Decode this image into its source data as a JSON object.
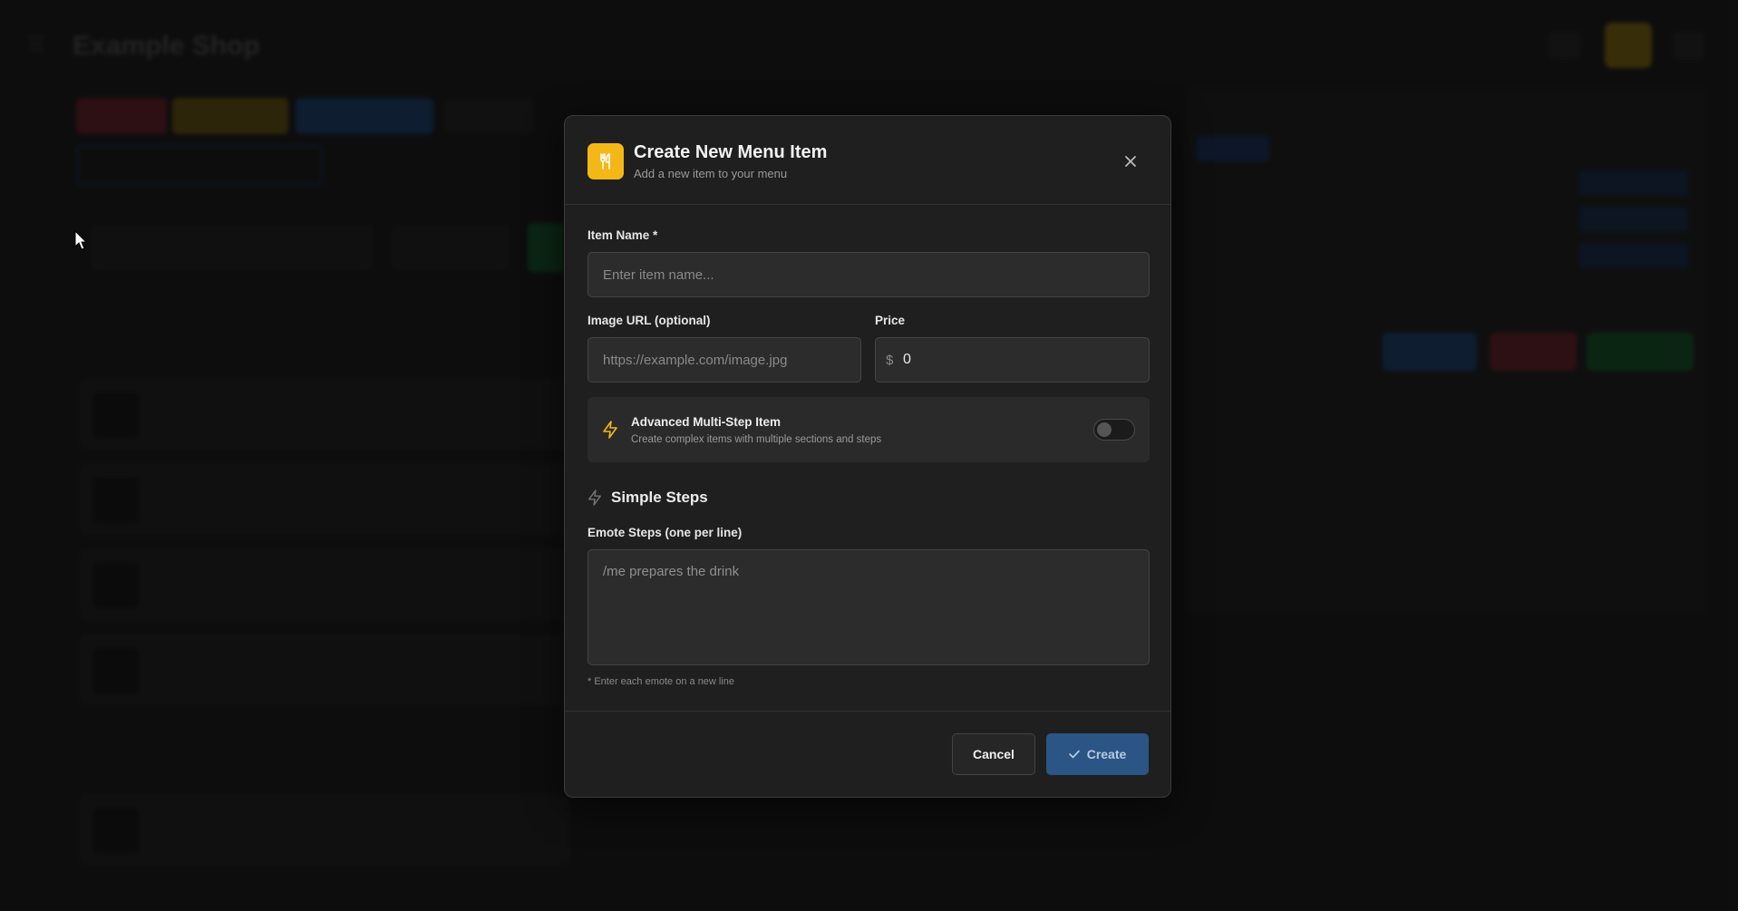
{
  "app": {
    "title": "Example Shop"
  },
  "modal": {
    "title": "Create New Menu Item",
    "subtitle": "Add a new item to your menu",
    "header_icon": "utensils-icon",
    "close_icon": "close-icon",
    "item_name": {
      "label": "Item Name *",
      "placeholder": "Enter item name...",
      "value": ""
    },
    "image_url": {
      "label": "Image URL (optional)",
      "placeholder": "https://example.com/image.jpg",
      "value": ""
    },
    "price": {
      "label": "Price",
      "prefix": "$",
      "value": "0"
    },
    "advanced": {
      "title": "Advanced Multi-Step Item",
      "description": "Create complex items with multiple sections and steps",
      "enabled": false,
      "icon": "lightning-icon"
    },
    "simple_steps": {
      "title": "Simple Steps",
      "icon": "lightning-icon",
      "steps_label": "Emote Steps (one per line)",
      "steps_placeholder": "/me prepares the drink",
      "hint": "* Enter each emote on a new line"
    },
    "footer": {
      "cancel_label": "Cancel",
      "create_label": "Create",
      "create_icon": "check-icon"
    }
  },
  "colors": {
    "accent_yellow": "#f3b717",
    "primary_blue": "#2a5585",
    "modal_bg": "#1f1f1f",
    "page_bg": "#161616"
  }
}
